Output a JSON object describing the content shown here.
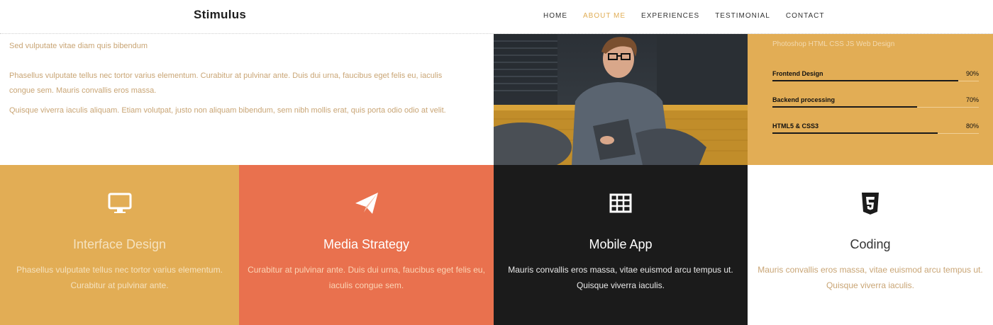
{
  "brand": "Stimulus",
  "nav": {
    "items": [
      {
        "label": "HOME"
      },
      {
        "label": "ABOUT ME"
      },
      {
        "label": "EXPERIENCES"
      },
      {
        "label": "TESTIMONIAL"
      },
      {
        "label": "CONTACT"
      }
    ],
    "active_index": 1
  },
  "about": {
    "tagline": "Sed vulputate vitae diam quis bibendum",
    "para1": "Phasellus vulputate tellus nec tortor varius elementum. Curabitur at pulvinar ante. Duis dui urna, faucibus eget felis eu, iaculis congue sem. Mauris convallis eros massa.",
    "para2": "Quisque viverra iaculis aliquam. Etiam volutpat, justo non aliquam bibendum, sem nibh mollis erat, quis porta odio odio at velit."
  },
  "skills": {
    "tags": "Photoshop   HTML CSS JS   Web Design",
    "items": [
      {
        "name": "Frontend Design",
        "percent": "90%",
        "value": 90
      },
      {
        "name": "Backend processing",
        "percent": "70%",
        "value": 70
      },
      {
        "name": "HTML5 & CSS3",
        "percent": "80%",
        "value": 80
      }
    ]
  },
  "services": [
    {
      "title": "Interface Design",
      "icon": "monitor-icon",
      "desc": "Phasellus vulputate tellus nec tortor varius elementum. Curabitur at pulvinar ante."
    },
    {
      "title": "Media Strategy",
      "icon": "paper-plane-icon",
      "desc": "Curabitur at pulvinar ante. Duis dui urna, faucibus eget felis eu, iaculis congue sem."
    },
    {
      "title": "Mobile App",
      "icon": "table-icon",
      "desc": "Mauris convallis eros massa, vitae euismod arcu tempus ut. Quisque viverra iaculis."
    },
    {
      "title": "Coding",
      "icon": "html5-icon",
      "desc": "Mauris convallis eros massa, vitae euismod arcu tempus ut. Quisque viverra iaculis."
    }
  ],
  "colors": {
    "accent": "#e2ad55",
    "orange": "#e9714e",
    "dark": "#1b1b1b"
  }
}
